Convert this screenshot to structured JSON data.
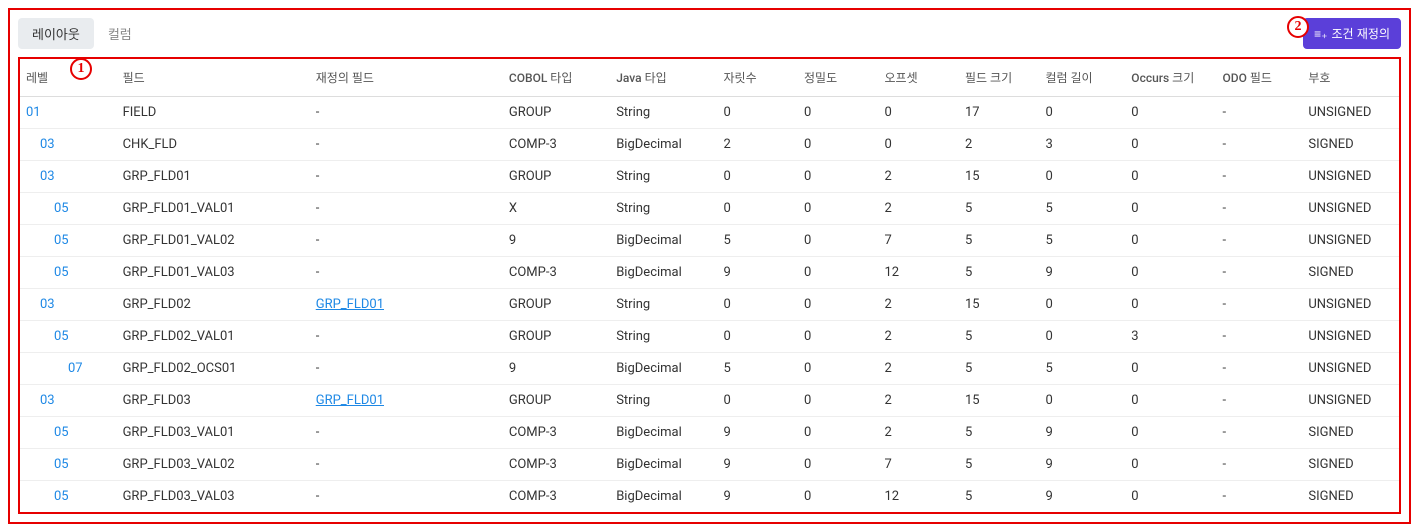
{
  "tabs": {
    "layout": "레이아웃",
    "column": "컬럼"
  },
  "button": {
    "redefine": "조건 재정의"
  },
  "annotations": {
    "a1": "1",
    "a2": "2"
  },
  "columns": {
    "level": "레벨",
    "field": "필드",
    "redef": "재정의 필드",
    "cobol_type": "COBOL 타입",
    "java_type": "Java 타입",
    "digits": "자릿수",
    "precision": "정밀도",
    "offset": "오프셋",
    "field_size": "필드 크기",
    "column_length": "컬럼 길이",
    "occurs_size": "Occurs 크기",
    "odo_field": "ODO 필드",
    "sign": "부호"
  },
  "rows": [
    {
      "level": "01",
      "indent": 0,
      "field": "FIELD",
      "redef": "-",
      "redef_link": false,
      "cobol": "GROUP",
      "java": "String",
      "digits": "0",
      "precision": "0",
      "offset": "0",
      "fsize": "17",
      "clen": "0",
      "occurs": "0",
      "odo": "-",
      "sign": "UNSIGNED"
    },
    {
      "level": "03",
      "indent": 1,
      "field": "CHK_FLD",
      "redef": "-",
      "redef_link": false,
      "cobol": "COMP-3",
      "java": "BigDecimal",
      "digits": "2",
      "precision": "0",
      "offset": "0",
      "fsize": "2",
      "clen": "3",
      "occurs": "0",
      "odo": "-",
      "sign": "SIGNED"
    },
    {
      "level": "03",
      "indent": 1,
      "field": "GRP_FLD01",
      "redef": "-",
      "redef_link": false,
      "cobol": "GROUP",
      "java": "String",
      "digits": "0",
      "precision": "0",
      "offset": "2",
      "fsize": "15",
      "clen": "0",
      "occurs": "0",
      "odo": "-",
      "sign": "UNSIGNED"
    },
    {
      "level": "05",
      "indent": 2,
      "field": "GRP_FLD01_VAL01",
      "redef": "-",
      "redef_link": false,
      "cobol": "X",
      "java": "String",
      "digits": "0",
      "precision": "0",
      "offset": "2",
      "fsize": "5",
      "clen": "5",
      "occurs": "0",
      "odo": "-",
      "sign": "UNSIGNED"
    },
    {
      "level": "05",
      "indent": 2,
      "field": "GRP_FLD01_VAL02",
      "redef": "-",
      "redef_link": false,
      "cobol": "9",
      "java": "BigDecimal",
      "digits": "5",
      "precision": "0",
      "offset": "7",
      "fsize": "5",
      "clen": "5",
      "occurs": "0",
      "odo": "-",
      "sign": "UNSIGNED"
    },
    {
      "level": "05",
      "indent": 2,
      "field": "GRP_FLD01_VAL03",
      "redef": "-",
      "redef_link": false,
      "cobol": "COMP-3",
      "java": "BigDecimal",
      "digits": "9",
      "precision": "0",
      "offset": "12",
      "fsize": "5",
      "clen": "9",
      "occurs": "0",
      "odo": "-",
      "sign": "SIGNED"
    },
    {
      "level": "03",
      "indent": 1,
      "field": "GRP_FLD02",
      "redef": "GRP_FLD01",
      "redef_link": true,
      "cobol": "GROUP",
      "java": "String",
      "digits": "0",
      "precision": "0",
      "offset": "2",
      "fsize": "15",
      "clen": "0",
      "occurs": "0",
      "odo": "-",
      "sign": "UNSIGNED"
    },
    {
      "level": "05",
      "indent": 2,
      "field": "GRP_FLD02_VAL01",
      "redef": "-",
      "redef_link": false,
      "cobol": "GROUP",
      "java": "String",
      "digits": "0",
      "precision": "0",
      "offset": "2",
      "fsize": "5",
      "clen": "0",
      "occurs": "3",
      "odo": "-",
      "sign": "UNSIGNED"
    },
    {
      "level": "07",
      "indent": 3,
      "field": "GRP_FLD02_OCS01",
      "redef": "-",
      "redef_link": false,
      "cobol": "9",
      "java": "BigDecimal",
      "digits": "5",
      "precision": "0",
      "offset": "2",
      "fsize": "5",
      "clen": "5",
      "occurs": "0",
      "odo": "-",
      "sign": "UNSIGNED"
    },
    {
      "level": "03",
      "indent": 1,
      "field": "GRP_FLD03",
      "redef": "GRP_FLD01",
      "redef_link": true,
      "cobol": "GROUP",
      "java": "String",
      "digits": "0",
      "precision": "0",
      "offset": "2",
      "fsize": "15",
      "clen": "0",
      "occurs": "0",
      "odo": "-",
      "sign": "UNSIGNED"
    },
    {
      "level": "05",
      "indent": 2,
      "field": "GRP_FLD03_VAL01",
      "redef": "-",
      "redef_link": false,
      "cobol": "COMP-3",
      "java": "BigDecimal",
      "digits": "9",
      "precision": "0",
      "offset": "2",
      "fsize": "5",
      "clen": "9",
      "occurs": "0",
      "odo": "-",
      "sign": "SIGNED"
    },
    {
      "level": "05",
      "indent": 2,
      "field": "GRP_FLD03_VAL02",
      "redef": "-",
      "redef_link": false,
      "cobol": "COMP-3",
      "java": "BigDecimal",
      "digits": "9",
      "precision": "0",
      "offset": "7",
      "fsize": "5",
      "clen": "9",
      "occurs": "0",
      "odo": "-",
      "sign": "SIGNED"
    },
    {
      "level": "05",
      "indent": 2,
      "field": "GRP_FLD03_VAL03",
      "redef": "-",
      "redef_link": false,
      "cobol": "COMP-3",
      "java": "BigDecimal",
      "digits": "9",
      "precision": "0",
      "offset": "12",
      "fsize": "5",
      "clen": "9",
      "occurs": "0",
      "odo": "-",
      "sign": "SIGNED"
    }
  ]
}
